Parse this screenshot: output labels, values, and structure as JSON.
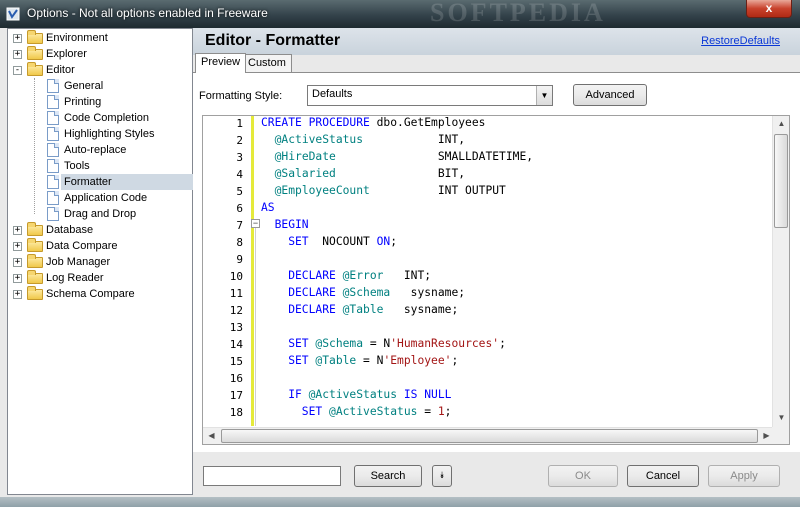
{
  "window": {
    "title": "Options - Not all options enabled in Freeware",
    "close_label": "x",
    "watermark": "SOFTPEDIA"
  },
  "tree": {
    "items": [
      {
        "label": "Environment",
        "expander": "+"
      },
      {
        "label": "Explorer",
        "expander": "+"
      },
      {
        "label": "Editor",
        "expander": "-"
      },
      {
        "label": "General"
      },
      {
        "label": "Printing"
      },
      {
        "label": "Code Completion"
      },
      {
        "label": "Highlighting Styles"
      },
      {
        "label": "Auto-replace"
      },
      {
        "label": "Tools"
      },
      {
        "label": "Formatter",
        "selected": true
      },
      {
        "label": "Application Code"
      },
      {
        "label": "Drag and Drop"
      },
      {
        "label": "Database",
        "expander": "+"
      },
      {
        "label": "Data Compare",
        "expander": "+"
      },
      {
        "label": "Job Manager",
        "expander": "+"
      },
      {
        "label": "Log Reader",
        "expander": "+"
      },
      {
        "label": "Schema Compare",
        "expander": "+"
      }
    ]
  },
  "header": {
    "title": "Editor - Formatter",
    "restore_link": "RestoreDefaults"
  },
  "tabs": [
    {
      "label": "Preview",
      "active": true
    },
    {
      "label": "Custom",
      "active": false
    }
  ],
  "formatting": {
    "label": "Formatting Style:",
    "selected": "Defaults",
    "advanced_label": "Advanced"
  },
  "editor": {
    "line_numbers": [
      "1",
      "2",
      "3",
      "4",
      "5",
      "6",
      "7",
      "8",
      "9",
      "10",
      "11",
      "12",
      "13",
      "14",
      "15",
      "16",
      "17",
      "18"
    ],
    "lines": [
      [
        {
          "t": "CREATE PROCEDURE ",
          "c": "kw"
        },
        {
          "t": "dbo.GetEmployees",
          "c": "txt"
        }
      ],
      [
        {
          "t": "  ",
          "c": "txt"
        },
        {
          "t": "@ActiveStatus",
          "c": "var"
        },
        {
          "t": "           INT,",
          "c": "txt"
        }
      ],
      [
        {
          "t": "  ",
          "c": "txt"
        },
        {
          "t": "@HireDate",
          "c": "var"
        },
        {
          "t": "               SMALLDATETIME,",
          "c": "txt"
        }
      ],
      [
        {
          "t": "  ",
          "c": "txt"
        },
        {
          "t": "@Salaried",
          "c": "var"
        },
        {
          "t": "               BIT,",
          "c": "txt"
        }
      ],
      [
        {
          "t": "  ",
          "c": "txt"
        },
        {
          "t": "@EmployeeCount",
          "c": "var"
        },
        {
          "t": "          INT OUTPUT",
          "c": "txt"
        }
      ],
      [
        {
          "t": "AS",
          "c": "kw"
        }
      ],
      [
        {
          "t": "  BEGIN",
          "c": "kw"
        }
      ],
      [
        {
          "t": "    SET",
          "c": "kw"
        },
        {
          "t": "  NOCOUNT ",
          "c": "txt"
        },
        {
          "t": "ON",
          "c": "kw"
        },
        {
          "t": ";",
          "c": "txt"
        }
      ],
      [],
      [
        {
          "t": "    DECLARE ",
          "c": "kw"
        },
        {
          "t": "@Error",
          "c": "var"
        },
        {
          "t": "   INT;",
          "c": "txt"
        }
      ],
      [
        {
          "t": "    DECLARE ",
          "c": "kw"
        },
        {
          "t": "@Schema",
          "c": "var"
        },
        {
          "t": "   sysname;",
          "c": "txt"
        }
      ],
      [
        {
          "t": "    DECLARE ",
          "c": "kw"
        },
        {
          "t": "@Table",
          "c": "var"
        },
        {
          "t": "   sysname;",
          "c": "txt"
        }
      ],
      [],
      [
        {
          "t": "    SET ",
          "c": "kw"
        },
        {
          "t": "@Schema",
          "c": "var"
        },
        {
          "t": " = N",
          "c": "txt"
        },
        {
          "t": "'HumanResources'",
          "c": "str"
        },
        {
          "t": ";",
          "c": "txt"
        }
      ],
      [
        {
          "t": "    SET ",
          "c": "kw"
        },
        {
          "t": "@Table",
          "c": "var"
        },
        {
          "t": " = N",
          "c": "txt"
        },
        {
          "t": "'Employee'",
          "c": "str"
        },
        {
          "t": ";",
          "c": "txt"
        }
      ],
      [],
      [
        {
          "t": "    IF ",
          "c": "kw"
        },
        {
          "t": "@ActiveStatus",
          "c": "var"
        },
        {
          "t": " IS NULL",
          "c": "kw"
        }
      ],
      [
        {
          "t": "      SET ",
          "c": "kw"
        },
        {
          "t": "@ActiveStatus",
          "c": "var"
        },
        {
          "t": " = ",
          "c": "txt"
        },
        {
          "t": "1",
          "c": "str"
        },
        {
          "t": ";",
          "c": "txt"
        }
      ]
    ]
  },
  "footer": {
    "search_value": "",
    "search_label": "Search",
    "ok_label": "OK",
    "cancel_label": "Cancel",
    "apply_label": "Apply"
  }
}
